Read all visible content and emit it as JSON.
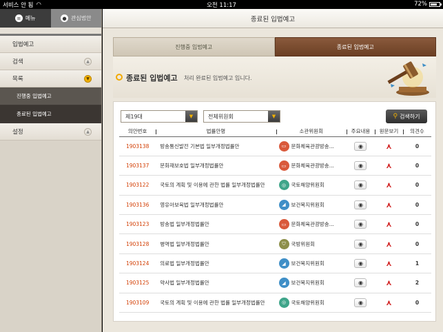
{
  "status": {
    "carrier": "서비스 안 됨",
    "time": "오전 11:17",
    "battery": "72%",
    "battery_level": 0.72
  },
  "sidebar": {
    "tabs": [
      {
        "label": "메뉴",
        "icon": "menu-icon"
      },
      {
        "label": "관심법안",
        "icon": "user-icon"
      }
    ],
    "items": [
      {
        "label": "입법예고"
      },
      {
        "label": "검색"
      },
      {
        "label": "목록"
      },
      {
        "label": "설정"
      }
    ],
    "subitems": [
      {
        "label": "진행중 입법예고"
      },
      {
        "label": "종료된 입법예고"
      }
    ]
  },
  "main": {
    "title": "종료된 입법예고",
    "tabs": [
      {
        "label": "진행중 입법예고"
      },
      {
        "label": "종료된 입법예고"
      }
    ],
    "heading": "종료된 입법예고",
    "description": "처리 완료된 입법예고 입니다."
  },
  "filters": {
    "session": "제19대",
    "committee": "전체위원회",
    "search_label": "검색하기"
  },
  "table": {
    "headers": [
      "의안번호",
      "법률안명",
      "소관위원회",
      "주요내용",
      "원문보기",
      "의견수"
    ],
    "rows": [
      {
        "num": "1903138",
        "law": "방송통신발전 기본법 일부개정법률안",
        "comm": "문화체육관광방송...",
        "comm_color": "#d9593b",
        "comm_icon": "tv-icon",
        "count": "0"
      },
      {
        "num": "1903137",
        "law": "문화재보호법 일부개정법률안",
        "comm": "문화체육관광방송...",
        "comm_color": "#d9593b",
        "comm_icon": "tv-icon",
        "count": "0"
      },
      {
        "num": "1903122",
        "law": "국토의 계획 및 이용에 관한 법률 일부개정법률안",
        "comm": "국토해양위원회",
        "comm_color": "#3fa58a",
        "comm_icon": "globe-icon",
        "count": "0"
      },
      {
        "num": "1903136",
        "law": "영유아보육법 일부개정법률안",
        "comm": "보건복지위원회",
        "comm_color": "#3f8fc7",
        "comm_icon": "health-icon",
        "count": "0"
      },
      {
        "num": "1903123",
        "law": "방송법 일부개정법률안",
        "comm": "문화체육관광방송...",
        "comm_color": "#d9593b",
        "comm_icon": "tv-icon",
        "count": "0"
      },
      {
        "num": "1903128",
        "law": "병역법 일부개정법률안",
        "comm": "국방위원회",
        "comm_color": "#8d8f4a",
        "comm_icon": "shield-icon",
        "count": "0"
      },
      {
        "num": "1903124",
        "law": "의료법 일부개정법률안",
        "comm": "보건복지위원회",
        "comm_color": "#3f8fc7",
        "comm_icon": "health-icon",
        "count": "1"
      },
      {
        "num": "1903125",
        "law": "약사법 일부개정법률안",
        "comm": "보건복지위원회",
        "comm_color": "#3f8fc7",
        "comm_icon": "health-icon",
        "count": "2"
      },
      {
        "num": "1903109",
        "law": "국토의 계획 및 이용에 관한 법률 일부개정법률안",
        "comm": "국토해양위원회",
        "comm_color": "#3fa58a",
        "comm_icon": "globe-icon",
        "count": "0"
      }
    ]
  }
}
